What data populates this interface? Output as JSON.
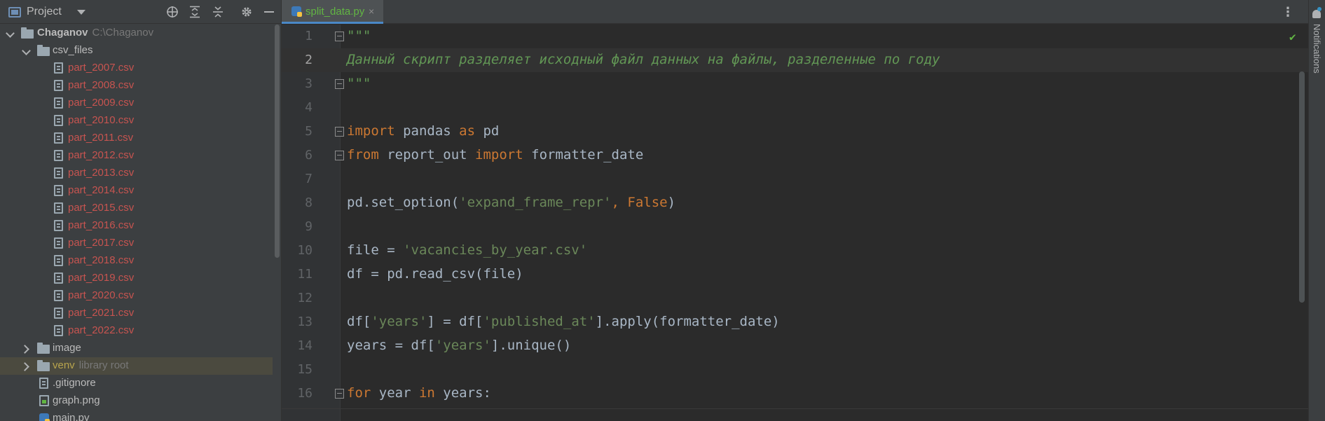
{
  "project": {
    "title": "Project",
    "root": {
      "name": "Chaganov",
      "path": "C:\\Chaganov"
    },
    "folders": {
      "csv_files": "csv_files",
      "image": "image",
      "venv": "venv",
      "venv_hint": "library root"
    },
    "csv_files": [
      "part_2007.csv",
      "part_2008.csv",
      "part_2009.csv",
      "part_2010.csv",
      "part_2011.csv",
      "part_2012.csv",
      "part_2013.csv",
      "part_2014.csv",
      "part_2015.csv",
      "part_2016.csv",
      "part_2017.csv",
      "part_2018.csv",
      "part_2019.csv",
      "part_2020.csv",
      "part_2021.csv",
      "part_2022.csv"
    ],
    "files": {
      "gitignore": ".gitignore",
      "graph": "graph.png",
      "main": "main.py"
    }
  },
  "editor": {
    "tab_label": "split_data.py",
    "tab_close": "×",
    "more_icon": "⋮",
    "check": "✔",
    "current_line": 2,
    "lines": [
      {
        "n": "1"
      },
      {
        "n": "2"
      },
      {
        "n": "3"
      },
      {
        "n": "4"
      },
      {
        "n": "5"
      },
      {
        "n": "6"
      },
      {
        "n": "7"
      },
      {
        "n": "8"
      },
      {
        "n": "9"
      },
      {
        "n": "10"
      },
      {
        "n": "11"
      },
      {
        "n": "12"
      },
      {
        "n": "13"
      },
      {
        "n": "14"
      },
      {
        "n": "15"
      },
      {
        "n": "16"
      }
    ],
    "code": {
      "l1": "\"\"\"",
      "l2": "Данный скрипт разделяет исходный файл данных на файлы, разделенные по году",
      "l3": "\"\"\"",
      "l5_kw1": "import",
      "l5_a": " pandas ",
      "l5_kw2": "as",
      "l5_b": " pd",
      "l6_kw1": "from",
      "l6_a": " report_out ",
      "l6_kw2": "import",
      "l6_b": " formatter_date",
      "l8_a": "pd.set_option(",
      "l8_str": "'expand_frame_repr'",
      "l8_sep": ", ",
      "l8_kw": "False",
      "l8_b": ")",
      "l10_a": "file = ",
      "l10_str": "'vacancies_by_year.csv'",
      "l11_a": "df = pd.read_csv(file)",
      "l13_a": "df[",
      "l13_s1": "'years'",
      "l13_b": "] = df[",
      "l13_s2": "'published_at'",
      "l13_c": "].apply(formatter_date)",
      "l14_a": "years = df[",
      "l14_s1": "'years'",
      "l14_b": "].unique()",
      "l16_kw1": "for",
      "l16_a": " year ",
      "l16_kw2": "in",
      "l16_b": " years:"
    }
  },
  "notifications": {
    "label": "Notifications"
  },
  "colors": {
    "keyword": "#cc7832",
    "string": "#6a8759",
    "docstring": "#629755",
    "modified_file": "#c75450",
    "accent": "#4a88c7"
  }
}
